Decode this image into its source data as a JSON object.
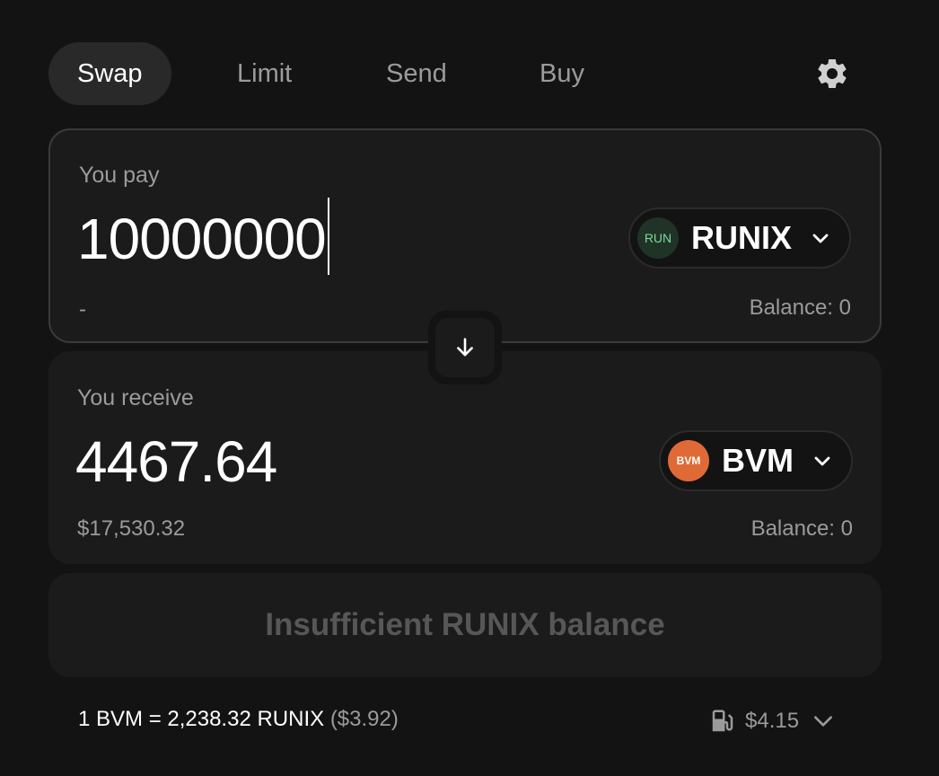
{
  "tabs": [
    {
      "label": "Swap"
    },
    {
      "label": "Limit"
    },
    {
      "label": "Send"
    },
    {
      "label": "Buy"
    }
  ],
  "icons": {
    "settings": "gear-icon",
    "dropdown": "chevron-down-icon",
    "flip": "arrow-down-icon",
    "gas": "gas-pump-icon"
  },
  "pay": {
    "label": "You pay",
    "amount": "10000000",
    "usd_value": "-",
    "balance": "Balance: 0",
    "token": {
      "symbol": "RUNIX",
      "logo_text": "RUN",
      "logo_color": "#1f3326",
      "logo_text_color": "#7ed99a"
    }
  },
  "receive": {
    "label": "You receive",
    "amount": "4467.64",
    "usd_value": "$17,530.32",
    "balance": "Balance: 0",
    "token": {
      "symbol": "BVM",
      "logo_text": "BVM",
      "logo_color": "#e06a36"
    }
  },
  "action_button": "Insufficient RUNIX balance",
  "rate": {
    "text": "1 BVM = 2,238.32 RUNIX",
    "usd": "($3.92)"
  },
  "gas_fee": "$4.15",
  "colors": {
    "background": "#131313",
    "panel": "#1b1b1b",
    "muted_text": "#9b9b9b",
    "disabled_text": "#575757"
  }
}
